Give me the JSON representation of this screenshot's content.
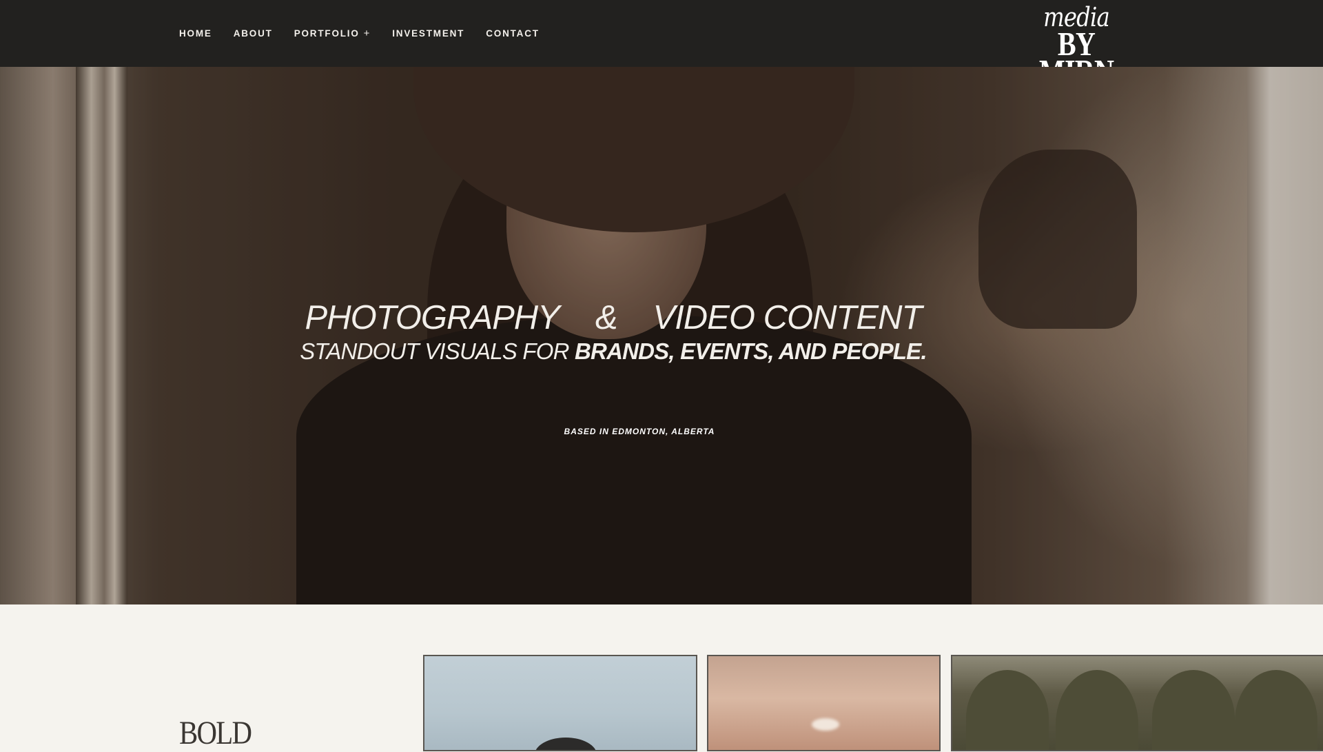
{
  "nav": {
    "links": [
      {
        "label": "HOME"
      },
      {
        "label": "ABOUT"
      },
      {
        "label": "PORTFOLIO",
        "suffix": "+"
      },
      {
        "label": "INVESTMENT"
      },
      {
        "label": "CONTACT"
      }
    ],
    "logo": {
      "top": "media",
      "bottom": "BY MIRN"
    }
  },
  "hero": {
    "title_part1": "PHOTOGRAPHY",
    "title_amp": "&",
    "title_part2": "VIDEO CONTENT",
    "subtitle_lead": "STANDOUT VISUALS FOR ",
    "subtitle_bold": "BRANDS, EVENTS, AND PEOPLE.",
    "location": "BASED IN EDMONTON, ALBERTA"
  },
  "section": {
    "heading": "BOLD"
  },
  "colors": {
    "nav_bg": "#22211f",
    "page_bg": "#f5f3ee",
    "nav_text": "#f4f1ec",
    "heading_text": "#3a3632"
  }
}
